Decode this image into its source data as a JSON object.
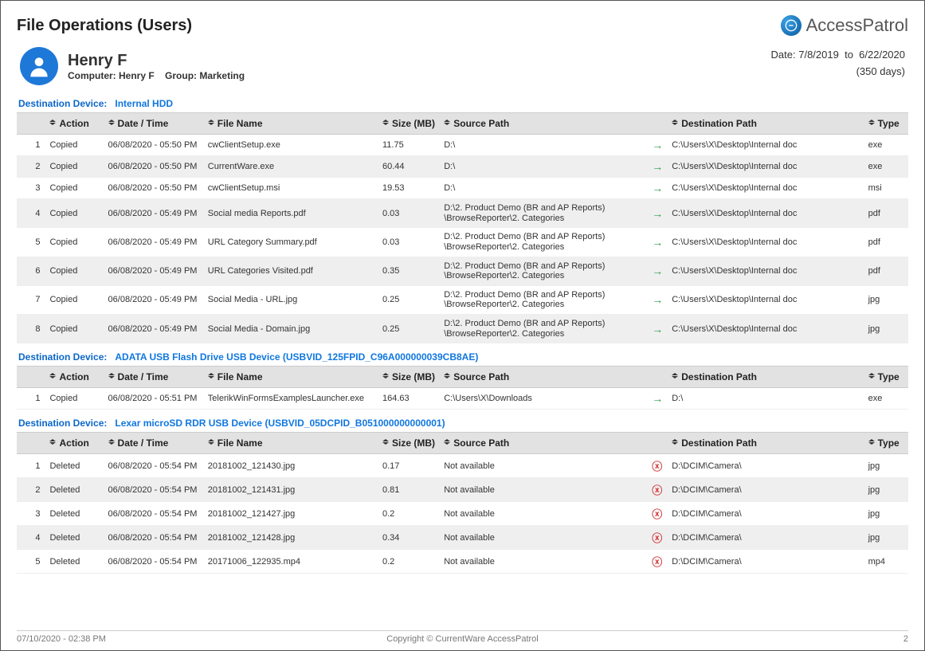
{
  "page_title": "File Operations (Users)",
  "brand": "AccessPatrol",
  "user": {
    "name": "Henry F",
    "computer_label": "Computer:",
    "computer": "Henry F",
    "group_label": "Group:",
    "group": "Marketing"
  },
  "date_range": {
    "prefix": "Date:",
    "from": "7/8/2019",
    "sep": "to",
    "to": "6/22/2020",
    "days": "(350 days)"
  },
  "columns": {
    "action": "Action",
    "datetime": "Date / Time",
    "filename": "File Name",
    "size": "Size (MB)",
    "source": "Source Path",
    "dest": "Destination Path",
    "type": "Type"
  },
  "device_label": "Destination Device:",
  "devices": [
    {
      "name": "Internal HDD",
      "rows": [
        {
          "idx": "1",
          "action": "Copied",
          "dt": "06/08/2020 - 05:50 PM",
          "fn": "cwClientSetup.exe",
          "sz": "11.75",
          "sp": "D:\\",
          "icon": "arrow",
          "dp": "C:\\Users\\X\\Desktop\\Internal doc",
          "tp": "exe"
        },
        {
          "idx": "2",
          "action": "Copied",
          "dt": "06/08/2020 - 05:50 PM",
          "fn": "CurrentWare.exe",
          "sz": "60.44",
          "sp": "D:\\",
          "icon": "arrow",
          "dp": "C:\\Users\\X\\Desktop\\Internal doc",
          "tp": "exe"
        },
        {
          "idx": "3",
          "action": "Copied",
          "dt": "06/08/2020 - 05:50 PM",
          "fn": "cwClientSetup.msi",
          "sz": "19.53",
          "sp": "D:\\",
          "icon": "arrow",
          "dp": "C:\\Users\\X\\Desktop\\Internal doc",
          "tp": "msi"
        },
        {
          "idx": "4",
          "action": "Copied",
          "dt": "06/08/2020 - 05:49 PM",
          "fn": "Social media Reports.pdf",
          "sz": "0.03",
          "sp": "D:\\2. Product Demo (BR and AP Reports)\\BrowseReporter\\2. Categories",
          "icon": "arrow",
          "dp": "C:\\Users\\X\\Desktop\\Internal doc",
          "tp": "pdf"
        },
        {
          "idx": "5",
          "action": "Copied",
          "dt": "06/08/2020 - 05:49 PM",
          "fn": "URL Category Summary.pdf",
          "sz": "0.03",
          "sp": "D:\\2. Product Demo (BR and AP Reports)\\BrowseReporter\\2. Categories",
          "icon": "arrow",
          "dp": "C:\\Users\\X\\Desktop\\Internal doc",
          "tp": "pdf"
        },
        {
          "idx": "6",
          "action": "Copied",
          "dt": "06/08/2020 - 05:49 PM",
          "fn": "URL Categories Visited.pdf",
          "sz": "0.35",
          "sp": "D:\\2. Product Demo (BR and AP Reports)\\BrowseReporter\\2. Categories",
          "icon": "arrow",
          "dp": "C:\\Users\\X\\Desktop\\Internal doc",
          "tp": "pdf"
        },
        {
          "idx": "7",
          "action": "Copied",
          "dt": "06/08/2020 - 05:49 PM",
          "fn": "Social Media - URL.jpg",
          "sz": "0.25",
          "sp": "D:\\2. Product Demo (BR and AP Reports)\\BrowseReporter\\2. Categories",
          "icon": "arrow",
          "dp": "C:\\Users\\X\\Desktop\\Internal doc",
          "tp": "jpg"
        },
        {
          "idx": "8",
          "action": "Copied",
          "dt": "06/08/2020 - 05:49 PM",
          "fn": "Social Media - Domain.jpg",
          "sz": "0.25",
          "sp": "D:\\2. Product Demo (BR and AP Reports)\\BrowseReporter\\2. Categories",
          "icon": "arrow",
          "dp": "C:\\Users\\X\\Desktop\\Internal doc",
          "tp": "jpg"
        }
      ]
    },
    {
      "name": "ADATA USB Flash Drive USB Device (USBVID_125FPID_C96A000000039CB8AE)",
      "rows": [
        {
          "idx": "1",
          "action": "Copied",
          "dt": "06/08/2020 - 05:51 PM",
          "fn": "TelerikWinFormsExamplesLauncher.exe",
          "sz": "164.63",
          "sp": "C:\\Users\\X\\Downloads",
          "icon": "arrow",
          "dp": "D:\\",
          "tp": "exe"
        }
      ]
    },
    {
      "name": "Lexar microSD RDR USB Device (USBVID_05DCPID_B051000000000001)",
      "rows": [
        {
          "idx": "1",
          "action": "Deleted",
          "dt": "06/08/2020 - 05:54 PM",
          "fn": "20181002_121430.jpg",
          "sz": "0.17",
          "sp": "Not available",
          "icon": "x",
          "dp": "D:\\DCIM\\Camera\\",
          "tp": "jpg"
        },
        {
          "idx": "2",
          "action": "Deleted",
          "dt": "06/08/2020 - 05:54 PM",
          "fn": "20181002_121431.jpg",
          "sz": "0.81",
          "sp": "Not available",
          "icon": "x",
          "dp": "D:\\DCIM\\Camera\\",
          "tp": "jpg"
        },
        {
          "idx": "3",
          "action": "Deleted",
          "dt": "06/08/2020 - 05:54 PM",
          "fn": "20181002_121427.jpg",
          "sz": "0.2",
          "sp": "Not available",
          "icon": "x",
          "dp": "D:\\DCIM\\Camera\\",
          "tp": "jpg"
        },
        {
          "idx": "4",
          "action": "Deleted",
          "dt": "06/08/2020 - 05:54 PM",
          "fn": "20181002_121428.jpg",
          "sz": "0.34",
          "sp": "Not available",
          "icon": "x",
          "dp": "D:\\DCIM\\Camera\\",
          "tp": "jpg"
        },
        {
          "idx": "5",
          "action": "Deleted",
          "dt": "06/08/2020 - 05:54 PM",
          "fn": "20171006_122935.mp4",
          "sz": "0.2",
          "sp": "Not available",
          "icon": "x",
          "dp": "D:\\DCIM\\Camera\\",
          "tp": "mp4"
        }
      ]
    }
  ],
  "footer": {
    "left": "07/10/2020 - 02:38 PM",
    "center": "Copyright © CurrentWare AccessPatrol",
    "right": "2"
  }
}
